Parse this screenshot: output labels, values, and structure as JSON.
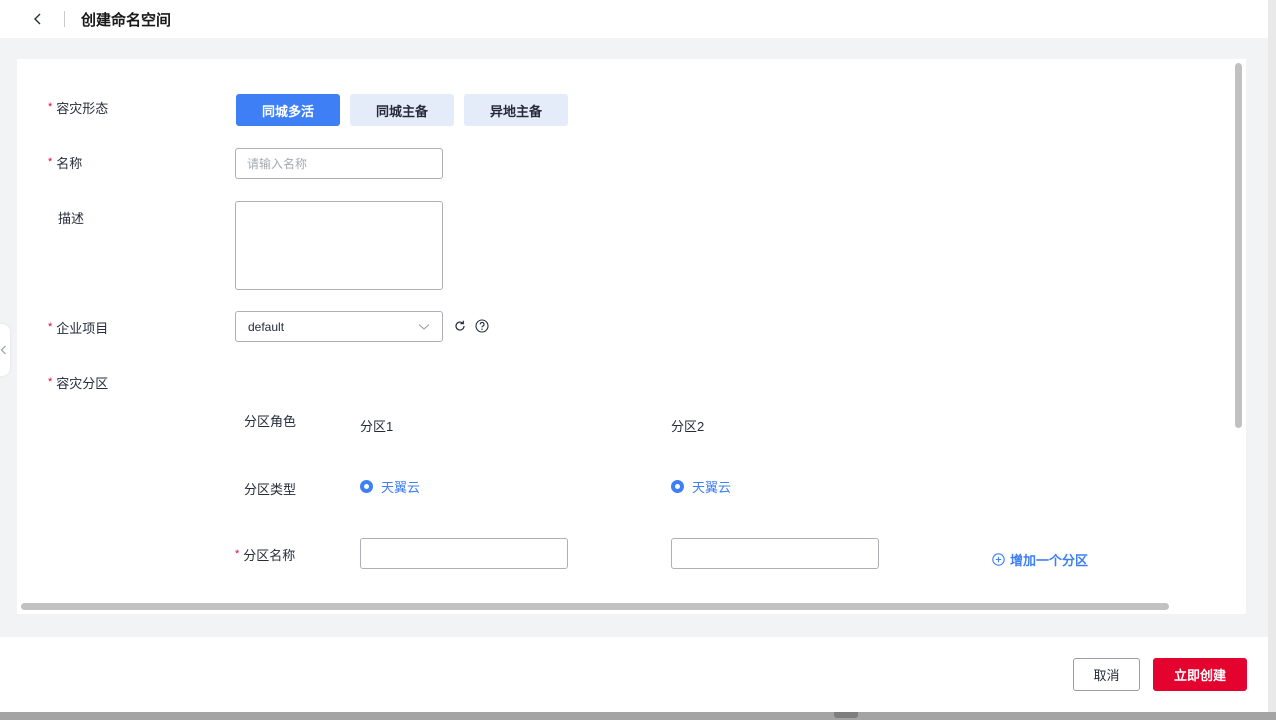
{
  "header": {
    "title": "创建命名空间"
  },
  "form": {
    "dr_mode": {
      "label": "容灾形态",
      "options": [
        "同城多活",
        "同城主备",
        "异地主备"
      ],
      "selected": "同城多活"
    },
    "name": {
      "label": "名称",
      "placeholder": "请输入名称",
      "value": ""
    },
    "description": {
      "label": "描述",
      "value": ""
    },
    "project": {
      "label": "企业项目",
      "value": "default"
    },
    "partitions": {
      "label": "容灾分区",
      "role_label": "分区角色",
      "type_label": "分区类型",
      "name_label": "分区名称",
      "columns": [
        {
          "role": "分区1",
          "type": "天翼云",
          "name": ""
        },
        {
          "role": "分区2",
          "type": "天翼云",
          "name": ""
        }
      ],
      "add_label": "增加一个分区"
    }
  },
  "footer": {
    "cancel_label": "取消",
    "submit_label": "立即创建"
  },
  "colors": {
    "accent": "#3e7ff5",
    "primary_button": "#e3032e",
    "required": "#e6003d"
  }
}
